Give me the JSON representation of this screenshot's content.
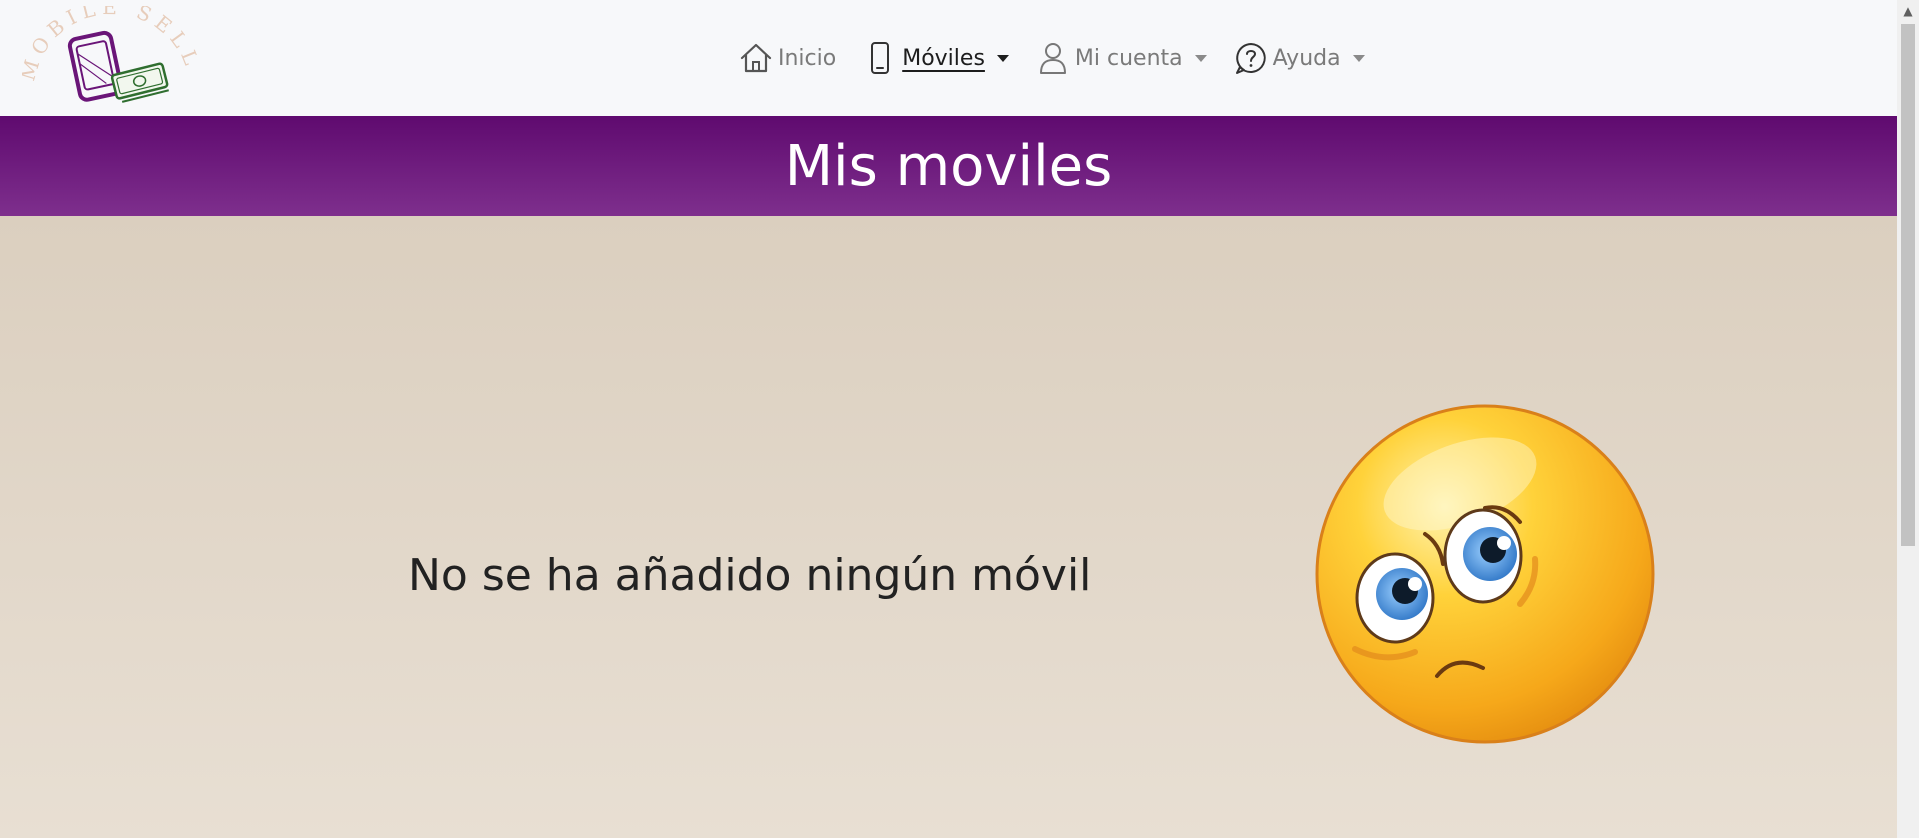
{
  "logo": {
    "text": "MOBILE SELL",
    "icon": "phone-money-logo"
  },
  "nav": [
    {
      "label": "Inicio",
      "icon": "home-icon",
      "dropdown": false,
      "active": false
    },
    {
      "label": "Móviles",
      "icon": "smartphone-icon",
      "dropdown": true,
      "active": true
    },
    {
      "label": "Mi cuenta",
      "icon": "user-icon",
      "dropdown": true,
      "active": false
    },
    {
      "label": "Ayuda",
      "icon": "help-circle-icon",
      "dropdown": true,
      "active": false
    }
  ],
  "banner": {
    "title": "Mis moviles"
  },
  "main": {
    "empty_message": "No se ha añadido ningún móvil",
    "illustration": "sad-face-emoji"
  },
  "colors": {
    "brand_purple": "#6a1578",
    "navbar_bg": "#f7f8fa",
    "content_bg": "#e3d8ca"
  }
}
